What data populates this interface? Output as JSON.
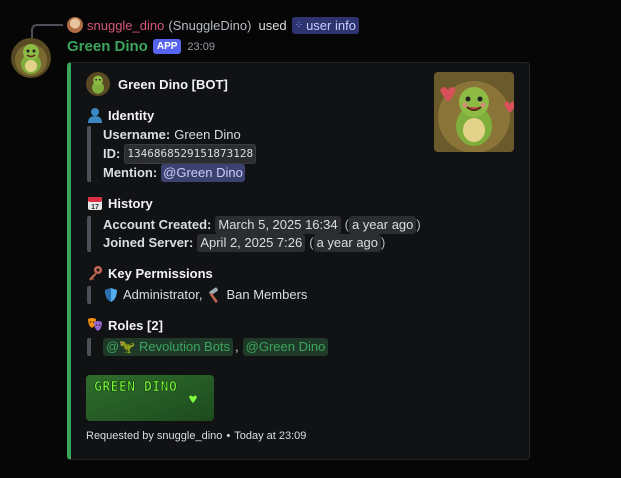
{
  "reply": {
    "username": "snuggle_dino",
    "handle": "(SnuggleDino)",
    "used_text": "used",
    "command_icon": "slash-command-icon",
    "command": "user info"
  },
  "message": {
    "username": "Green Dino",
    "app_badge": "APP",
    "time": "23:09"
  },
  "embed": {
    "accent_color": "#3ba55c",
    "author": "Green Dino [BOT]",
    "identity": {
      "icon": "person-silhouette-icon",
      "title": "Identity",
      "username_label": "Username:",
      "username_value": "Green Dino",
      "id_label": "ID:",
      "id_value": "1346868529151873128",
      "mention_label": "Mention:",
      "mention_value": "@Green Dino"
    },
    "history": {
      "icon": "calendar-icon",
      "title": "History",
      "created_label": "Account Created:",
      "created_value": "March 5, 2025 16:34",
      "created_relative": "a year ago",
      "joined_label": "Joined Server:",
      "joined_value": "April 2, 2025 7:26",
      "joined_relative": "a year ago"
    },
    "permissions": {
      "icon": "key-icon",
      "title": "Key Permissions",
      "items": [
        {
          "icon": "shield-icon",
          "label": "Administrator,"
        },
        {
          "icon": "hammer-icon",
          "label": "Ban Members"
        }
      ]
    },
    "roles": {
      "icon": "theater-masks-icon",
      "title": "Roles [2]",
      "items": [
        "@🦖 Revolution Bots",
        "@Green Dino"
      ],
      "separator": ","
    },
    "banner_text": "GREEN DINO",
    "footer": {
      "requested_by": "Requested by snuggle_dino",
      "dot": "•",
      "time": "Today at 23:09"
    }
  }
}
